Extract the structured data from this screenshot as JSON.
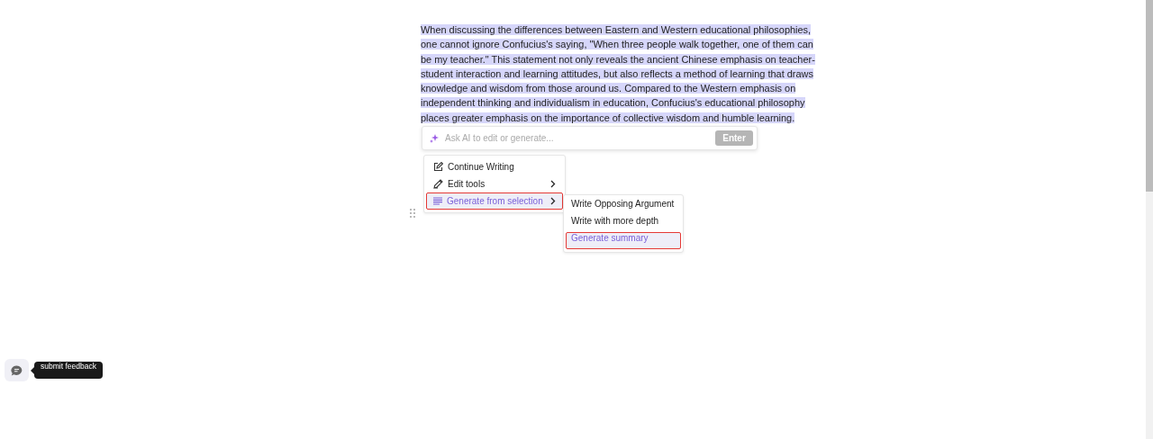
{
  "paragraph": {
    "text": "When discussing the differences between Eastern and Western educational philosophies, one cannot ignore Confucius's saying, \"When three people walk together, one of them can be my teacher.\" This statement not only reveals the ancient Chinese emphasis on teacher-student interaction and learning attitudes, but also reflects a method of learning that draws knowledge and wisdom from those around us. Compared to the Western emphasis on independent thinking and individualism in education, Confucius's educational philosophy places greater emphasis on the importance of collective wisdom and humble learning.",
    "selected": true
  },
  "ai_prompt": {
    "placeholder": "Ask AI to edit or generate...",
    "button": "Enter"
  },
  "menu": [
    {
      "label": "Continue Writing",
      "submenu": false,
      "selected": false
    },
    {
      "label": "Edit tools",
      "submenu": true,
      "selected": false
    },
    {
      "label": "Generate from selection",
      "submenu": true,
      "selected": true
    }
  ],
  "submenu": [
    {
      "label": "Write Opposing Argument",
      "selected": false
    },
    {
      "label": "Write with more depth",
      "selected": false
    },
    {
      "label": "Generate summary",
      "selected": true
    }
  ],
  "feedback": {
    "tooltip": "submit feedback"
  }
}
